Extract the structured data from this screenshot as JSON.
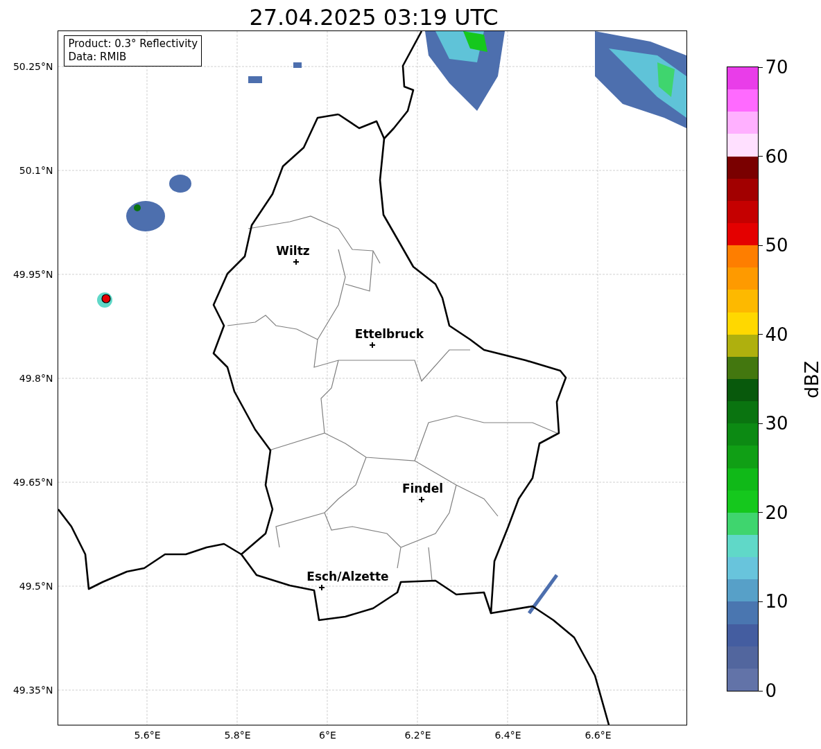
{
  "title": "27.04.2025 03:19 UTC",
  "info_box": [
    "Product: 0.3° Reflectivity",
    "Data: RMIB"
  ],
  "map": {
    "lat_ticks": [
      "50.25°N",
      "50.1°N",
      "49.95°N",
      "49.8°N",
      "49.65°N",
      "49.5°N",
      "49.35°N"
    ],
    "lon_ticks": [
      "5.6°E",
      "5.8°E",
      "6°E",
      "6.2°E",
      "6.4°E",
      "6.6°E"
    ],
    "cities": [
      {
        "name": "Wiltz"
      },
      {
        "name": "Ettelbruck"
      },
      {
        "name": "Findel"
      },
      {
        "name": "Esch/Alzette"
      }
    ]
  },
  "colorbar": {
    "label": "dBZ",
    "ticks": [
      "70",
      "60",
      "50",
      "40",
      "30",
      "20",
      "10",
      "0"
    ],
    "bins": [
      {
        "color": "#6273a8"
      },
      {
        "color": "#52669e"
      },
      {
        "color": "#445da0"
      },
      {
        "color": "#4a76b0"
      },
      {
        "color": "#57a0c8"
      },
      {
        "color": "#68c4dc"
      },
      {
        "color": "#60d8c8"
      },
      {
        "color": "#3fd56e"
      },
      {
        "color": "#15c81d"
      },
      {
        "color": "#10b918"
      },
      {
        "color": "#109f15"
      },
      {
        "color": "#0c8a13"
      },
      {
        "color": "#0a7410"
      },
      {
        "color": "#08590c"
      },
      {
        "color": "#43770f"
      },
      {
        "color": "#afb00e"
      },
      {
        "color": "#ffd800"
      },
      {
        "color": "#fdb900"
      },
      {
        "color": "#fe9a00"
      },
      {
        "color": "#fe7e00"
      },
      {
        "color": "#e40000"
      },
      {
        "color": "#c50000"
      },
      {
        "color": "#a20000"
      },
      {
        "color": "#7a0000"
      },
      {
        "color": "#ffe0ff"
      },
      {
        "color": "#ffb0ff"
      },
      {
        "color": "#ff6aff"
      },
      {
        "color": "#e93de9"
      }
    ]
  }
}
